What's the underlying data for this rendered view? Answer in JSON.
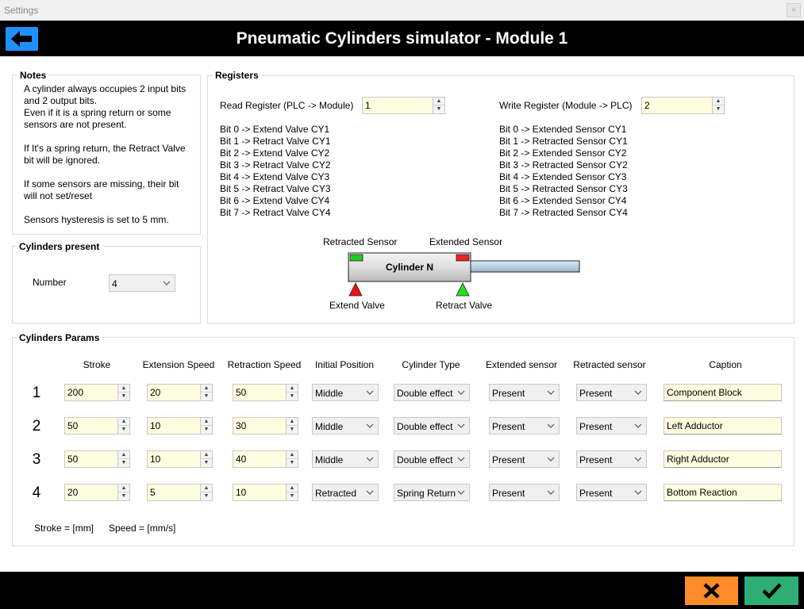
{
  "window": {
    "title": "Settings",
    "close_glyph": "×"
  },
  "header": {
    "title": "Pneumatic Cylinders simulator - Module 1",
    "back_icon": "arrow-left-icon"
  },
  "notes": {
    "title": "Notes",
    "lines": [
      "A cylinder always occupies 2 input bits",
      "and 2 output bits.",
      "Even if it is a spring return or some",
      "sensors are not present.",
      "If It's a spring return, the Retract Valve",
      "bit will be ignored.",
      "If some sensors are missing, their bit",
      "will not set/reset",
      "Sensors hysteresis is set to 5 mm."
    ]
  },
  "cylinders_present": {
    "title": "Cylinders present",
    "label": "Number",
    "value": "4"
  },
  "registers": {
    "title": "Registers",
    "read_label": "Read Register (PLC -> Module)",
    "read_value": "1",
    "write_label": "Write Register (Module -> PLC)",
    "write_value": "2",
    "read_bits": [
      "Bit 0 -> Extend Valve CY1",
      "Bit 1 -> Retract Valve CY1",
      "Bit 2 -> Extend Valve CY2",
      "Bit 3 -> Retract Valve CY2",
      "Bit 4 -> Extend Valve CY3",
      "Bit 5 -> Retract Valve CY3",
      "Bit 6 -> Extend Valve CY4",
      "Bit 7 -> Retract Valve CY4"
    ],
    "write_bits": [
      "Bit 0 -> Extended Sensor CY1",
      "Bit 1 -> Retracted Sensor CY1",
      "Bit 2 -> Extended Sensor CY2",
      "Bit 3 -> Retracted Sensor CY2",
      "Bit 4 -> Extended Sensor CY3",
      "Bit 5 -> Retracted Sensor CY3",
      "Bit 6 -> Extended Sensor CY4",
      "Bit 7 -> Retracted Sensor CY4"
    ],
    "diagram": {
      "retracted_sensor": "Retracted Sensor",
      "extended_sensor": "Extended Sensor",
      "cylinder_label": "Cylinder N",
      "extend_valve": "Extend Valve",
      "retract_valve": "Retract Valve",
      "colors": {
        "retracted_sensor": "#22cc22",
        "extended_sensor": "#ee2222",
        "extend_valve": "#ee1111",
        "retract_valve": "#22dd22"
      }
    }
  },
  "params": {
    "title": "Cylinders Params",
    "headers": {
      "stroke": "Stroke",
      "ext_speed": "Extension Speed",
      "ret_speed": "Retraction Speed",
      "init_pos": "Initial Position",
      "type": "Cylinder Type",
      "ext_sensor": "Extended sensor",
      "ret_sensor": "Retracted sensor",
      "caption": "Caption"
    },
    "rows": [
      {
        "num": "1",
        "stroke": "200",
        "ext_speed": "20",
        "ret_speed": "50",
        "init_pos": "Middle",
        "type": "Double effect",
        "ext_sensor": "Present",
        "ret_sensor": "Present",
        "caption": "Component Block"
      },
      {
        "num": "2",
        "stroke": "50",
        "ext_speed": "10",
        "ret_speed": "30",
        "init_pos": "Middle",
        "type": "Double effect",
        "ext_sensor": "Present",
        "ret_sensor": "Present",
        "caption": "Left Adductor"
      },
      {
        "num": "3",
        "stroke": "50",
        "ext_speed": "10",
        "ret_speed": "40",
        "init_pos": "Middle",
        "type": "Double effect",
        "ext_sensor": "Present",
        "ret_sensor": "Present",
        "caption": "Right Adductor"
      },
      {
        "num": "4",
        "stroke": "20",
        "ext_speed": "5",
        "ret_speed": "10",
        "init_pos": "Retracted",
        "type": "Spring Return",
        "ext_sensor": "Present",
        "ret_sensor": "Present",
        "caption": "Bottom Reaction"
      }
    ],
    "units_stroke": "Stroke = [mm]",
    "units_speed": "Speed = [mm/s]"
  },
  "footer": {
    "cancel_icon": "x-icon",
    "ok_icon": "checkmark-icon",
    "colors": {
      "cancel": "#ff8c28",
      "ok": "#2eae74"
    }
  }
}
